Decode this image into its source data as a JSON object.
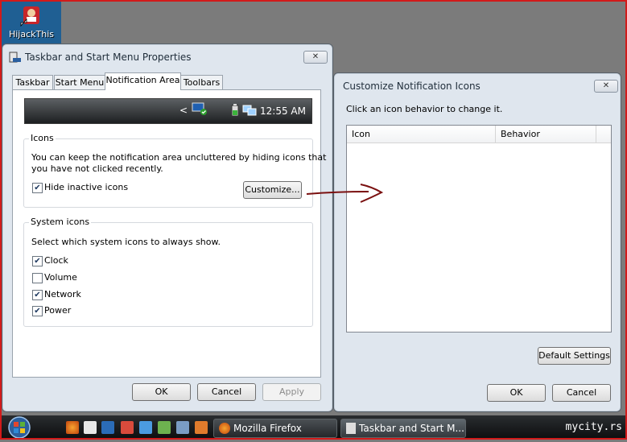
{
  "desktop": {
    "icon_label": "HijackThis"
  },
  "taskbar_props": {
    "title": "Taskbar and Start Menu Properties",
    "tabs": [
      "Taskbar",
      "Start Menu",
      "Notification Area",
      "Toolbars"
    ],
    "active_tab": "Notification Area",
    "preview_time": "12:55 AM",
    "preview_chevron": "<",
    "icons_group": {
      "title": "Icons",
      "description_line1": "You can keep the notification area uncluttered by hiding icons that",
      "description_line2": "you have not clicked recently.",
      "hide_inactive_label": "Hide inactive icons",
      "hide_inactive_checked": true,
      "customize_button": "Customize..."
    },
    "system_icons_group": {
      "title": "System icons",
      "description": "Select which system icons to always show.",
      "items": [
        {
          "label": "Clock",
          "checked": true
        },
        {
          "label": "Volume",
          "checked": false
        },
        {
          "label": "Network",
          "checked": true
        },
        {
          "label": "Power",
          "checked": true
        }
      ]
    },
    "buttons": {
      "ok": "OK",
      "cancel": "Cancel",
      "apply": "Apply"
    }
  },
  "customize_dialog": {
    "title": "Customize Notification Icons",
    "instruction": "Click an icon behavior to change it.",
    "columns": [
      "Icon",
      "Behavior"
    ],
    "default_settings_button": "Default Settings",
    "buttons": {
      "ok": "OK",
      "cancel": "Cancel"
    }
  },
  "taskbar": {
    "tasks": [
      "Mozilla Firefox",
      "Taskbar and Start M..."
    ],
    "watermark": "mycity.rs"
  },
  "colors": {
    "frame_border": "#d21a1a",
    "arrow": "#7a1010",
    "desktop": "#7b7b7b",
    "checkmark": "#1f3a60"
  },
  "icons": {
    "close": "close-icon",
    "check": "checkmark-icon",
    "start": "windows-start-orb-icon"
  }
}
